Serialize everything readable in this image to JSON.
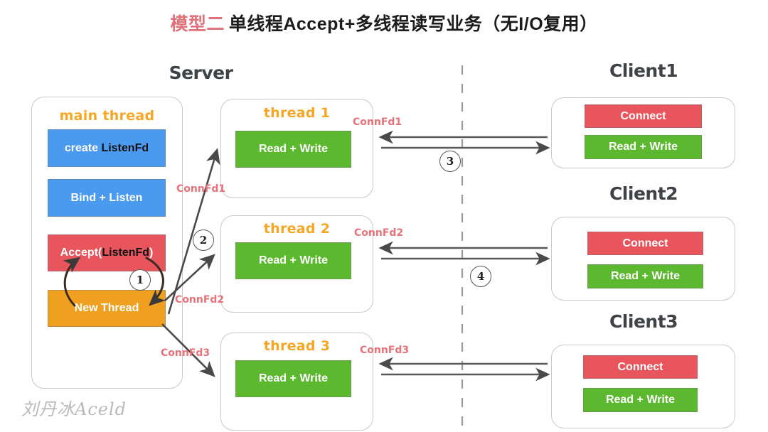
{
  "title": {
    "accent": "模型二",
    "rest": "单线程Accept+多线程读写业务（无I/O复用）",
    "accent_color": "#e0727b"
  },
  "sections": {
    "server_label": "Server",
    "clients": [
      "Client1",
      "Client2",
      "Client3"
    ]
  },
  "server": {
    "main_thread": {
      "title": "main thread",
      "blocks": [
        {
          "label": "create ListenFd",
          "color": "#4a9bf0",
          "name": "create-listenfd"
        },
        {
          "label": "Bind + Listen",
          "color": "#4a9bf0",
          "name": "bind-listen"
        },
        {
          "label": "Accept(ListenFd)",
          "color": "#e8555d",
          "name": "accept-listenfd"
        },
        {
          "label": "New Thread",
          "color": "#f0a020",
          "name": "new-thread"
        }
      ]
    },
    "threads": [
      {
        "title": "thread 1",
        "block": "Read + Write",
        "color": "#5cb82e"
      },
      {
        "title": "thread 2",
        "block": "Read + Write",
        "color": "#5cb82e"
      },
      {
        "title": "thread 3",
        "block": "Read + Write",
        "color": "#5cb82e"
      }
    ]
  },
  "clients": [
    {
      "name": "Client1",
      "blocks": [
        "Connect",
        "Read + Write"
      ]
    },
    {
      "name": "Client2",
      "blocks": [
        "Connect",
        "Read + Write"
      ]
    },
    {
      "name": "Client3",
      "blocks": [
        "Connect",
        "Read + Write"
      ]
    }
  ],
  "connfd_labels": {
    "spawn": [
      "ConnFd1",
      "ConnFd2",
      "ConnFd3"
    ],
    "link": [
      "ConnFd1",
      "ConnFd2",
      "ConnFd3"
    ]
  },
  "steps": [
    "1",
    "2",
    "3",
    "4"
  ],
  "signature": "刘丹冰Aceld",
  "colors": {
    "blue": "#4a9bf0",
    "red": "#e8555d",
    "orange": "#f0a020",
    "green": "#5cb82e",
    "connfd": "#e8727a",
    "card_border": "#c9c9c9",
    "arrow": "#4a4a4a",
    "divider": "#9a9a9a",
    "signature": "#b9b9b9"
  }
}
